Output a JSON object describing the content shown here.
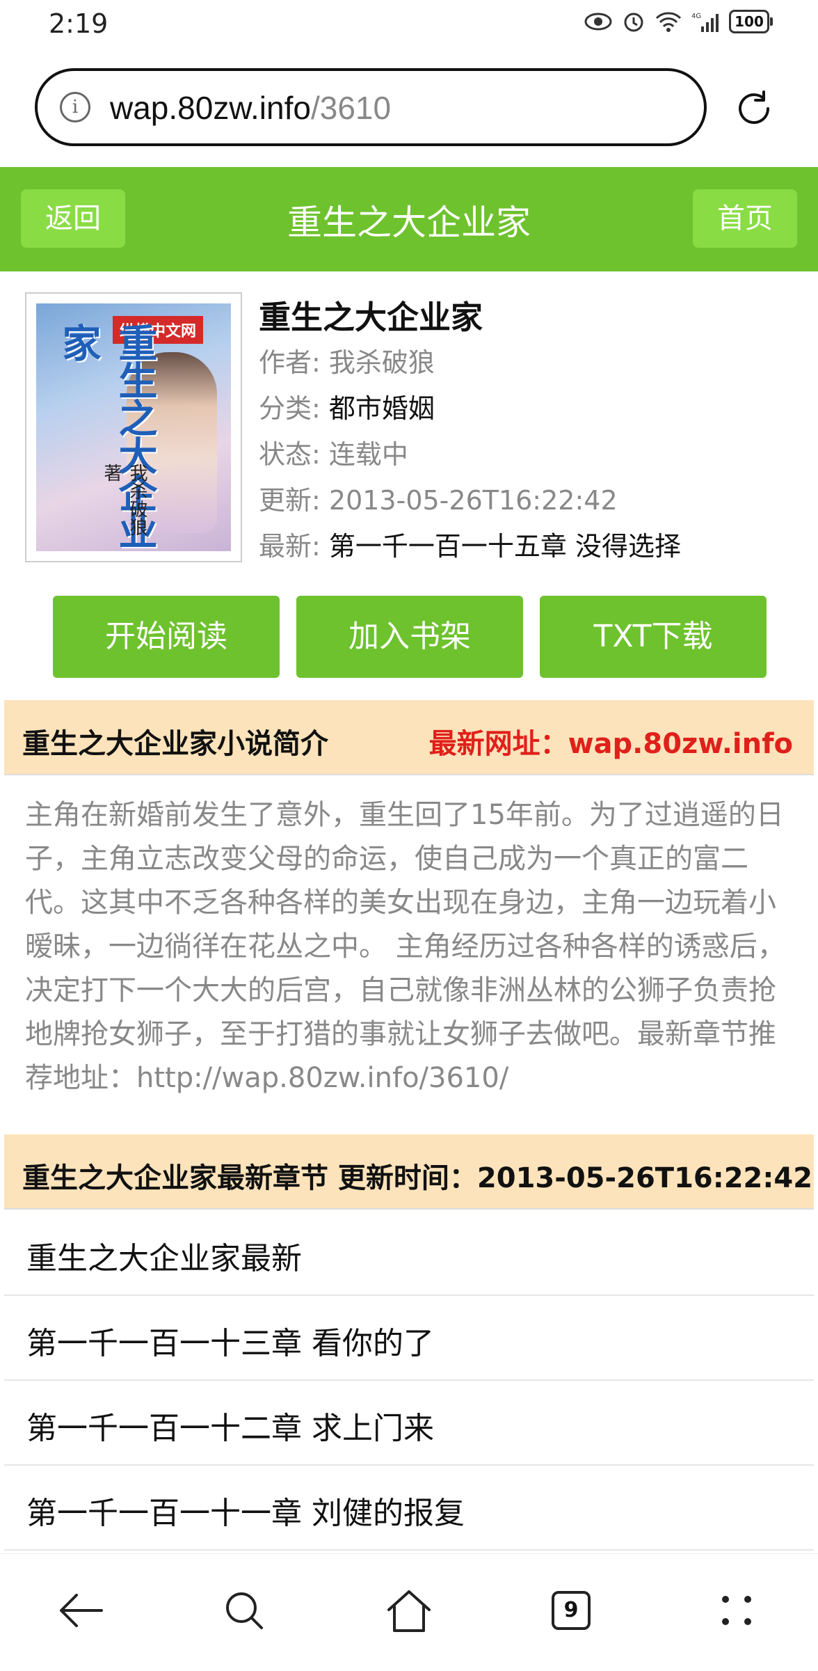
{
  "status": {
    "time": "2:19",
    "battery": "100",
    "network": "4G"
  },
  "browser": {
    "url_host": "wap.80zw.info",
    "url_path": "/3610",
    "tabs_count": "9"
  },
  "header": {
    "back_label": "返回",
    "title": "重生之大企业家",
    "home_label": "首页"
  },
  "book": {
    "title": "重生之大企业家",
    "cover_logo": "纵横中文网",
    "cover_title": "重生之大企业家",
    "cover_author": "我杀破狼 著",
    "author_key": "作者:",
    "author": "我杀破狼",
    "category_key": "分类:",
    "category": "都市婚姻",
    "status_key": "状态:",
    "status": "连载中",
    "updated_key": "更新:",
    "updated": "2013-05-26T16:22:42",
    "latest_key": "最新:",
    "latest": "第一千一百一十五章 没得选择"
  },
  "actions": {
    "read": "开始阅读",
    "shelf": "加入书架",
    "download": "TXT下载"
  },
  "intro": {
    "heading": "重生之大企业家小说简介",
    "site_label": "最新网址：wap.80zw.info",
    "text": "主角在新婚前发生了意外，重生回了15年前。为了过逍遥的日子，主角立志改变父母的命运，使自己成为一个真正的富二代。这其中不乏各种各样的美女出现在身边，主角一边玩着小暧昧，一边徜徉在花丛之中。 主角经历过各种各样的诱惑后，决定打下一个大大的后宫，自己就像非洲丛林的公狮子负责抢地牌抢女狮子，至于打猎的事就让女狮子去做吧。最新章节推荐地址：http://wap.80zw.info/3610/"
  },
  "latest_section": {
    "heading": "重生之大企业家最新章节 更新时间：2013-05-26T16:22:42"
  },
  "chapters": [
    "重生之大企业家最新",
    "第一千一百一十三章 看你的了",
    "第一千一百一十二章 求上门来",
    "第一千一百一十一章 刘健的报复"
  ],
  "colors": {
    "accent": "#6ec22e",
    "button_light": "#8adc45",
    "section_bg": "#fde3bb",
    "link_red": "#e0201a"
  }
}
